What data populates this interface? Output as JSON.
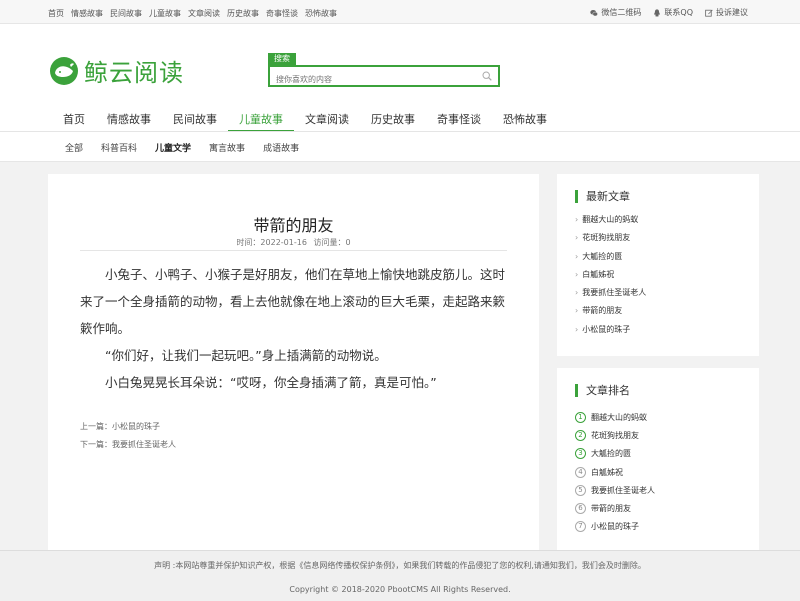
{
  "topbar": {
    "links": [
      "首页",
      "情感故事",
      "民间故事",
      "儿童故事",
      "文章阅读",
      "历史故事",
      "奇事怪谈",
      "恐怖故事"
    ],
    "wechat": "微信二维码",
    "qq": "联系QQ",
    "feedback": "投诉建议"
  },
  "header": {
    "logo_text": "鲸云阅读",
    "search_label": "搜索",
    "search_placeholder": "搜你喜欢的内容"
  },
  "nav": {
    "items": [
      "首页",
      "情感故事",
      "民间故事",
      "儿童故事",
      "文章阅读",
      "历史故事",
      "奇事怪谈",
      "恐怖故事"
    ],
    "active": "儿童故事"
  },
  "subnav": {
    "items": [
      "全部",
      "科普百科",
      "儿童文学",
      "寓言故事",
      "成语故事"
    ],
    "active": "儿童文学"
  },
  "article": {
    "title": "带箭的朋友",
    "date": "时间：2022-01-16",
    "views": "访问量：0",
    "paragraphs": [
      "小兔子、小鸭子、小猴子是好朋友，他们在草地上愉快地跳皮筋儿。这时来了一个全身插箭的动物，看上去他就像在地上滚动的巨大毛栗，走起路来簌簌作响。",
      "“你们好，让我们一起玩吧。”身上插满箭的动物说。",
      "小白兔晃晃长耳朵说：“哎呀，你全身插满了箭，真是可怕。”"
    ],
    "prev": "上一篇：小松鼠的珠子",
    "next": "下一篇：我要抓住圣诞老人"
  },
  "latest": {
    "title": "最新文章",
    "items": [
      "翻越大山的蚂蚁",
      "花斑狗找朋友",
      "大觚捡的匮",
      "白觚姊祝",
      "我要抓住圣诞老人",
      "带箭的朋友",
      "小松鼠的珠子"
    ]
  },
  "ranking": {
    "title": "文章排名",
    "items": [
      {
        "num": "1",
        "label": "翻越大山的蚂蚁"
      },
      {
        "num": "2",
        "label": "花斑狗找朋友"
      },
      {
        "num": "3",
        "label": "大觚捡的匮"
      },
      {
        "num": "4",
        "label": "白觚姊祝"
      },
      {
        "num": "5",
        "label": "我要抓住圣诞老人"
      },
      {
        "num": "6",
        "label": "带箭的朋友"
      },
      {
        "num": "7",
        "label": "小松鼠的珠子"
      }
    ]
  },
  "footer": {
    "notice": "声明 :本网站尊重并保护知识产权，根据《信息网络传播权保护条例》，如果我们转载的作品侵犯了您的权利,请通知我们，我们会及时删除。",
    "copyright": "Copyright © 2018-2020 PbootCMS All Rights Reserved."
  },
  "colors": {
    "accent": "#3ba23b"
  }
}
